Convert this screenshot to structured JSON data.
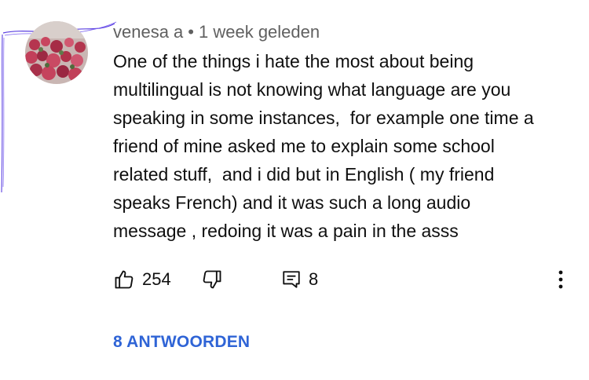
{
  "comment": {
    "author": "venesa a",
    "separator": "•",
    "timestamp": "1 week geleden",
    "text_lines": [
      "One of the things i hate the most about being",
      "multilingual is not knowing what language are you",
      "speaking in some instances,  for example one time a",
      "friend of mine asked me to explain some school",
      "related stuff,  and i did but in English ( my friend",
      "speaks French) and it was such a long audio",
      "message , redoing it was a pain in the asss"
    ]
  },
  "actions": {
    "like_count": "254",
    "reply_count": "8",
    "like_icon": "thumbs-up-icon",
    "dislike_icon": "thumbs-down-icon",
    "reply_icon": "comment-icon",
    "more_icon": "more-vertical-icon"
  },
  "replies": {
    "label": "8 ANTWOORDEN"
  },
  "colors": {
    "link": "#2f64d6",
    "meta": "#606060",
    "text": "#0f0f0f",
    "scribble": "#5a3fe0"
  }
}
